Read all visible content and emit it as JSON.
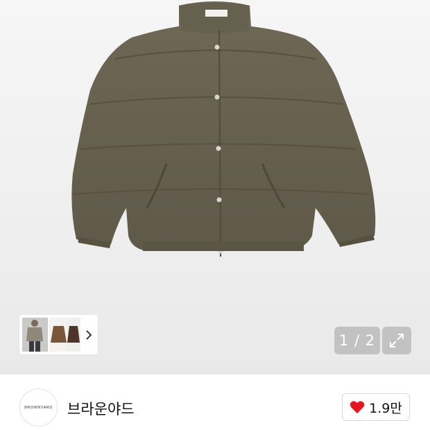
{
  "gallery": {
    "current_page": "1",
    "total_pages": "2",
    "counter_text": "1 / 2",
    "main_image_icon": "puffer-jacket-image",
    "thumbnails": [
      {
        "icon": "model-wearing-jacket-thumbnail"
      },
      {
        "icon": "brown-jacket-thumbnail"
      },
      {
        "icon": "dark-brown-jacket-thumbnail"
      }
    ],
    "next_icon": "chevron-right-icon",
    "expand_icon": "expand-icon"
  },
  "brand": {
    "logo_text": "BROWNYARD",
    "name": "브라운야드"
  },
  "like": {
    "icon": "heart-icon",
    "count": "1.9만",
    "heart_color": "#e8141f"
  },
  "colors": {
    "jacket": "#716a57",
    "background": "#efefef"
  }
}
